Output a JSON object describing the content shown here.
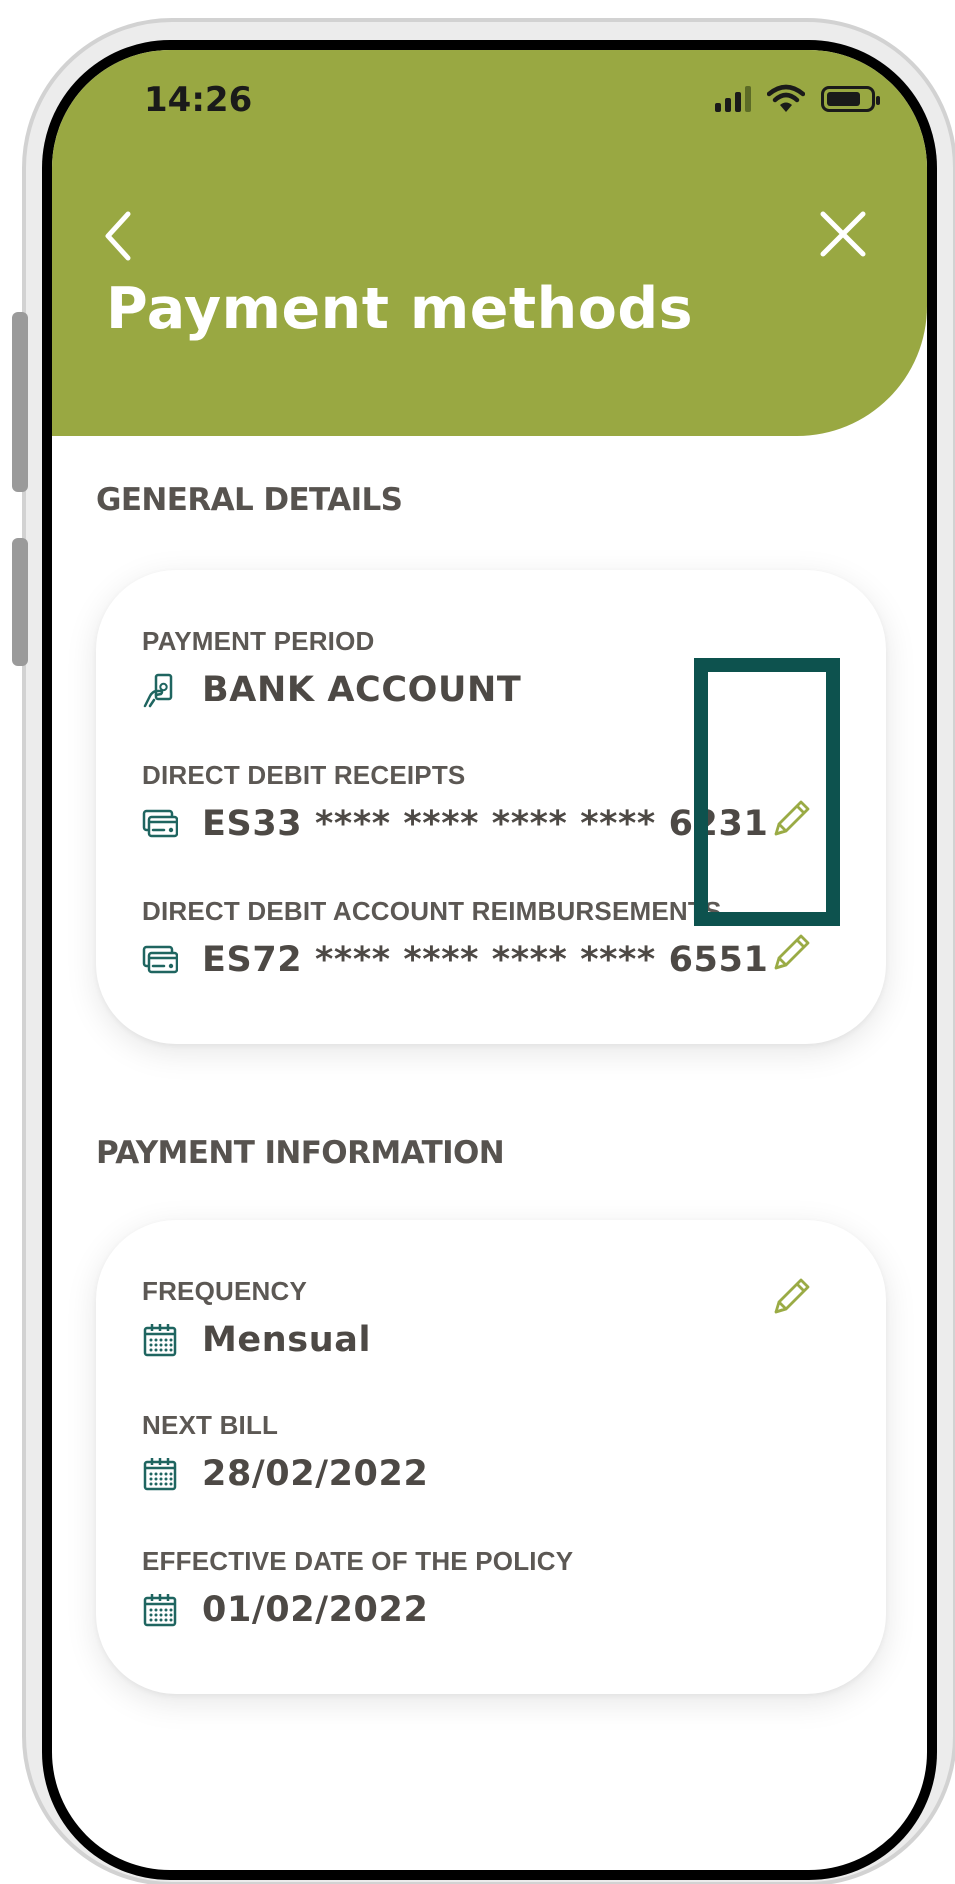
{
  "status_bar": {
    "time": "14:26"
  },
  "header": {
    "title": "Payment methods"
  },
  "general_details": {
    "section_title": "GENERAL DETAILS",
    "payment_period": {
      "label": "PAYMENT PERIOD",
      "value": "BANK ACCOUNT",
      "icon": "hand-card-icon"
    },
    "direct_debit_receipts": {
      "label": "DIRECT DEBIT RECEIPTS",
      "value": "ES33 **** **** **** **** 6231",
      "icon": "bank-card-icon"
    },
    "direct_debit_reimbursements": {
      "label": "DIRECT DEBIT ACCOUNT REIMBURSEMENTS",
      "value": "ES72 **** **** **** **** 6551",
      "icon": "bank-card-icon"
    }
  },
  "payment_information": {
    "section_title": "PAYMENT INFORMATION",
    "frequency": {
      "label": "FREQUENCY",
      "value": "Mensual",
      "icon": "calendar-icon"
    },
    "next_bill": {
      "label": "NEXT BILL",
      "value": "28/02/2022",
      "icon": "calendar-icon"
    },
    "effective_date": {
      "label": "EFFECTIVE DATE OF THE POLICY",
      "value": "01/02/2022",
      "icon": "calendar-icon"
    }
  },
  "colors": {
    "header_green": "#99a842",
    "edit_icon": "#9aab45",
    "icon_teal": "#1f6560",
    "highlight": "#0d524e",
    "text_dark": "#4d4945"
  }
}
